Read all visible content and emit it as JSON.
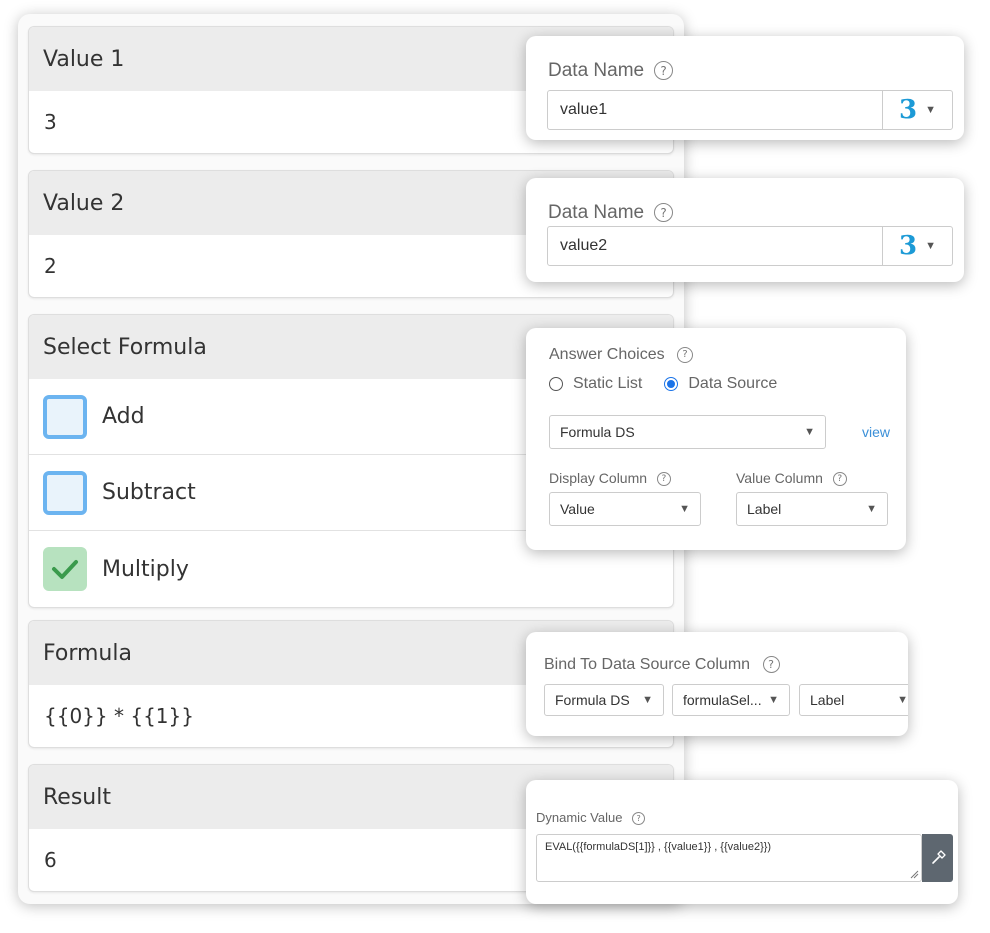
{
  "form": {
    "value1": {
      "label": "Value 1",
      "value": "3"
    },
    "value2": {
      "label": "Value 2",
      "value": "2"
    },
    "select_formula": {
      "label": "Select Formula",
      "options": [
        {
          "label": "Add",
          "checked": false
        },
        {
          "label": "Subtract",
          "checked": false
        },
        {
          "label": "Multiply",
          "checked": true
        }
      ]
    },
    "formula": {
      "label": "Formula",
      "value": "{{0}} * {{1}}"
    },
    "result": {
      "label": "Result",
      "value": "6"
    }
  },
  "data_name_1": {
    "label": "Data Name",
    "value": "value1",
    "glyph": "3"
  },
  "data_name_2": {
    "label": "Data Name",
    "value": "value2",
    "glyph": "3"
  },
  "answer_choices": {
    "label": "Answer Choices",
    "radio_static": "Static List",
    "radio_datasource": "Data Source",
    "selected": "Data Source",
    "datasource": "Formula DS",
    "view_link": "view",
    "display_column_label": "Display Column",
    "display_column_value": "Value",
    "value_column_label": "Value Column",
    "value_column_value": "Label"
  },
  "bind": {
    "label": "Bind To Data Source Column",
    "ds": "Formula DS",
    "field": "formulaSel...",
    "column": "Label"
  },
  "dynamic": {
    "label": "Dynamic Value",
    "expression": "EVAL({{formulaDS[1]}} , {{value1}} , {{value2}})"
  },
  "colors": {
    "checkbox_border": "#6cb4f0",
    "checkbox_checked_bg": "#b7e2bf",
    "check_mark": "#3a9a4c",
    "accent_blue": "#1c9ad6",
    "radio_blue": "#1a73e8",
    "link_blue": "#3a8fd8",
    "header_gray": "#ececec"
  }
}
